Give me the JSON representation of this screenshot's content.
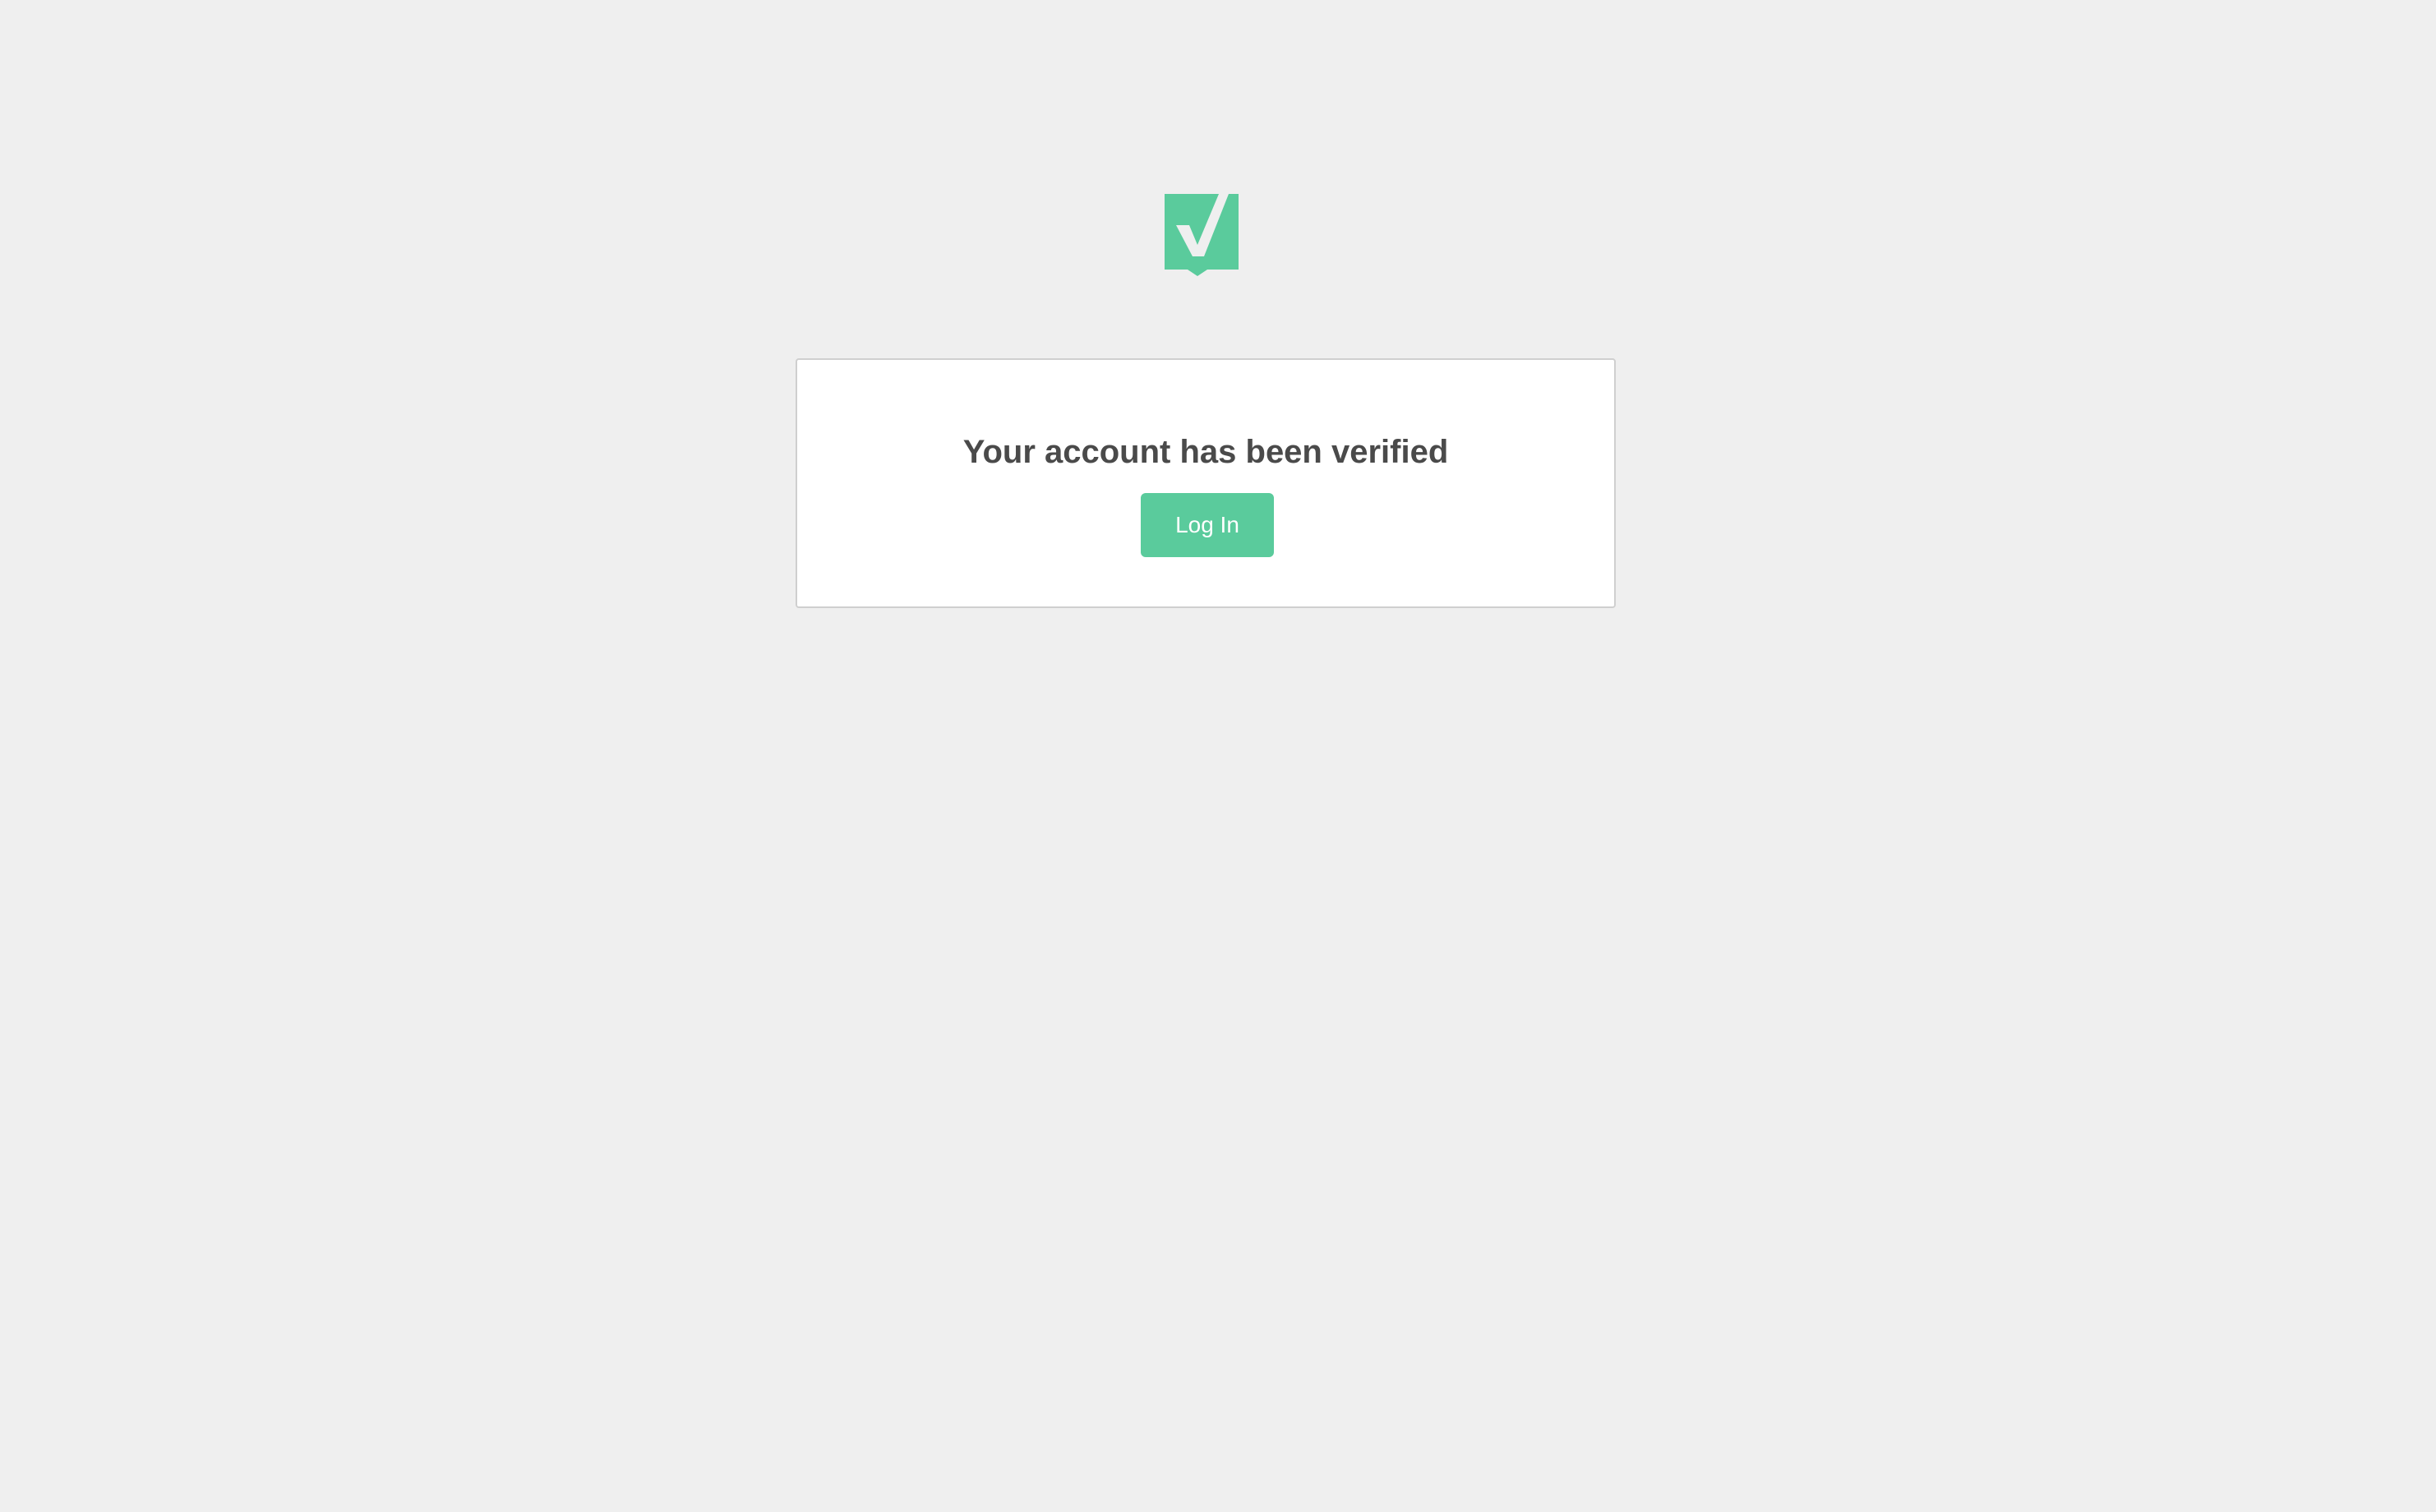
{
  "logo": {
    "icon": "checkmark-badge-icon",
    "color": "#5acb9c",
    "check_color": "#efefef"
  },
  "card": {
    "title": "Your account has been verified",
    "login_button_label": "Log In",
    "button_color": "#5acb9c"
  }
}
